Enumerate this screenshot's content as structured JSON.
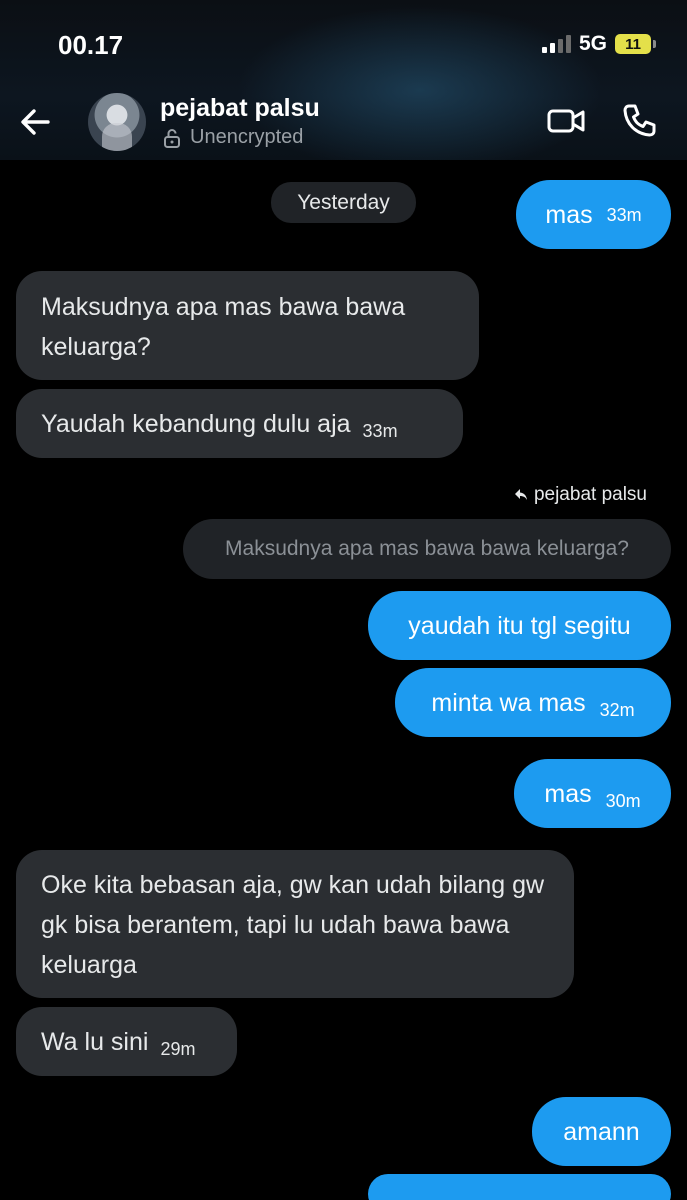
{
  "status_bar": {
    "time": "00.17",
    "network": "5G",
    "battery": "11"
  },
  "header": {
    "contact_name": "pejabat palsu",
    "encryption": "Unencrypted"
  },
  "icons": {
    "back": "arrow-left-icon",
    "lock": "lock-icon",
    "video": "video-camera-icon",
    "phone": "phone-icon",
    "reply": "reply-arrow-icon"
  },
  "colors": {
    "outgoing_bubble": "#1d9bf0",
    "incoming_bubble": "#2b2e32",
    "background": "#000000"
  },
  "date_separator": "Yesterday",
  "messages": [
    {
      "dir": "out",
      "text": "mas",
      "time": "33m"
    },
    {
      "dir": "in",
      "text": "Maksudnya apa mas bawa bawa keluarga?"
    },
    {
      "dir": "in",
      "text": "Yaudah kebandung dulu aja",
      "time": "33m"
    },
    {
      "dir": "out",
      "text": "yaudah itu tgl segitu"
    },
    {
      "dir": "out",
      "text": "minta wa mas",
      "time": "32m"
    },
    {
      "dir": "out",
      "text": "mas",
      "time": "30m"
    },
    {
      "dir": "in",
      "text": "Oke kita bebasan aja, gw kan udah bilang gw gk bisa berantem, tapi lu udah bawa bawa keluarga"
    },
    {
      "dir": "in",
      "text": "Wa lu sini",
      "time": "29m"
    },
    {
      "dir": "out",
      "text": "amann"
    }
  ],
  "reply": {
    "label": "pejabat palsu",
    "quoted_text": "Maksudnya apa mas bawa bawa keluarga?"
  }
}
